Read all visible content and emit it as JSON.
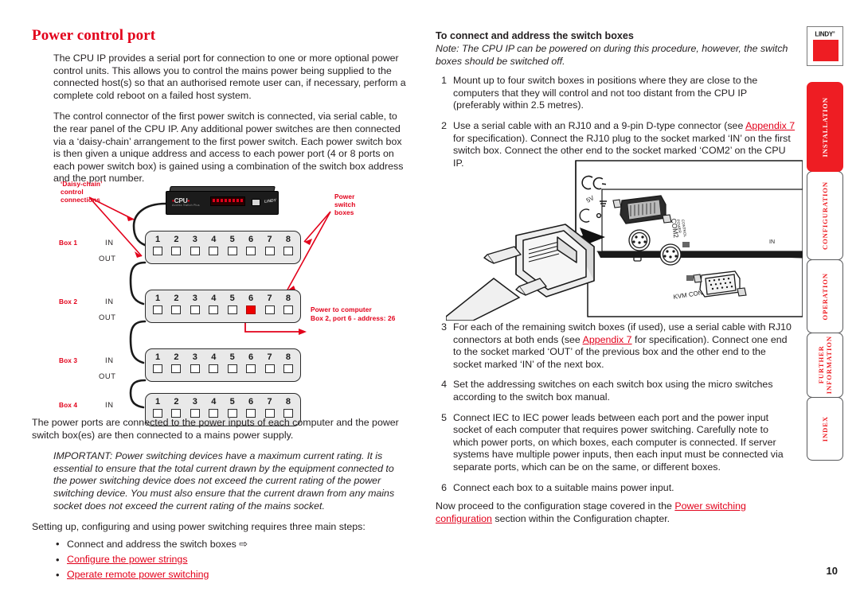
{
  "document": {
    "page_number": "10"
  },
  "left_column": {
    "title": "Power control port",
    "paragraphs": [
      "The CPU IP provides a serial port for connection to one or more optional power control units. This allows you to control the mains power being supplied to the connected host(s) so that an authorised remote user can, if necessary, perform a complete cold reboot on a failed host system.",
      "The control connector of the first power switch is connected, via serial cable, to the rear panel of the CPU IP. Any additional power switches are then connected via a ‘daisy-chain’ arrangement to the first power switch. Each power switch box is then given a unique address and access to each power port (4 or 8 ports on each power switch box) is gained using a combination of the switch box address and the port number."
    ],
    "after_diagram": "The power ports are connected to the power inputs of each computer and the power switch box(es) are then connected to a mains power supply.",
    "important_note": "IMPORTANT: Power switching devices have a maximum current rating. It is essential to ensure that the total current drawn by the equipment connected to the power switching device does not exceed the current rating of the power switching device. You must also ensure that the current drawn from any mains socket does not exceed the current rating of the mains socket.",
    "steps_intro": "Setting up, configuring and using power switching requires three main steps:",
    "bullets": [
      {
        "text": "Connect and address the switch boxes",
        "link": false,
        "arrow": "⇨"
      },
      {
        "text": "Configure the power strings",
        "link": true,
        "arrow": ""
      },
      {
        "text": "Operate remote power switching",
        "link": true,
        "arrow": ""
      }
    ]
  },
  "diagram": {
    "labels": {
      "daisy_chain": "‘Daisy-chain’\ncontrol\nconnections",
      "daisy_chain_l1": "‘Daisy-chain’",
      "daisy_chain_l2": "control",
      "daisy_chain_l3": "connections",
      "power_switch_boxes_l1": "Power",
      "power_switch_boxes_l2": "switch",
      "power_switch_boxes_l3": "boxes",
      "callout_l1": "Power to computer",
      "callout_l2": "Box 2, port 6 - address: 26",
      "in": "IN",
      "out": "OUT"
    },
    "device": {
      "logo": "CPU",
      "sub": "Access Switch Plus",
      "brand": "LINDY"
    },
    "boxes": [
      {
        "name": "Box 1",
        "has_in": true,
        "has_out": true,
        "ports": [
          "1",
          "2",
          "3",
          "4",
          "5",
          "6",
          "7",
          "8"
        ],
        "active_port": null
      },
      {
        "name": "Box 2",
        "has_in": true,
        "has_out": true,
        "ports": [
          "1",
          "2",
          "3",
          "4",
          "5",
          "6",
          "7",
          "8"
        ],
        "active_port": 6
      },
      {
        "name": "Box 3",
        "has_in": true,
        "has_out": true,
        "ports": [
          "1",
          "2",
          "3",
          "4",
          "5",
          "6",
          "7",
          "8"
        ],
        "active_port": null
      },
      {
        "name": "Box 4",
        "has_in": true,
        "has_out": false,
        "ports": [
          "1",
          "2",
          "3",
          "4",
          "5",
          "6",
          "7",
          "8"
        ],
        "active_port": null
      }
    ]
  },
  "right_column": {
    "title": "To connect and address the switch boxes",
    "note": "Note: The CPU IP can be powered on during this procedure, however, the switch boxes should be switched off.",
    "steps_group_1": [
      {
        "num": "1",
        "parts": [
          {
            "t": "Mount up to four switch boxes in positions where they are close to the computers that they will control and not too distant from the CPU IP (preferably within 2.5 metres).",
            "link": false
          }
        ]
      },
      {
        "num": "2",
        "parts": [
          {
            "t": "Use a serial cable with an RJ10 and a 9-pin D-type connector (see ",
            "link": false
          },
          {
            "t": "Appendix 7",
            "link": true
          },
          {
            "t": " for specification). Connect the RJ10 plug to the socket marked ‘IN’ on the first switch box. Connect the other end to the socket marked ‘COM2’ on the CPU IP.",
            "link": false
          }
        ]
      }
    ],
    "steps_group_2": [
      {
        "num": "3",
        "parts": [
          {
            "t": "For each of the remaining switch boxes (if used), use a serial cable with RJ10 connectors at both ends (see ",
            "link": false
          },
          {
            "t": "Appendix 7",
            "link": true
          },
          {
            "t": " for specification). Connect one end to the socket marked ‘OUT’ of the previous box and the other end to the socket marked ‘IN’ of the next box.",
            "link": false
          }
        ]
      },
      {
        "num": "4",
        "parts": [
          {
            "t": "Set the addressing switches on each switch box using the micro switches according to the switch box manual.",
            "link": false
          }
        ]
      },
      {
        "num": "5",
        "parts": [
          {
            "t": "Connect IEC to IEC power leads between each port and the power input socket of each computer that requires power switching. Carefully note to which power ports, on which boxes, each computer is connected. If server systems have multiple power inputs, then each input must be connected via separate ports, which can be on the same, or different boxes.",
            "link": false
          }
        ]
      },
      {
        "num": "6",
        "parts": [
          {
            "t": "Connect each box to a suitable mains power input.",
            "link": false
          }
        ]
      }
    ],
    "closing": [
      {
        "t": "Now proceed to the configuration stage covered in the ",
        "link": false
      },
      {
        "t": "Power switching configuration",
        "link": true
      },
      {
        "t": " section within the Configuration chapter.",
        "link": false
      }
    ],
    "illustration": {
      "labels": {
        "ce": "CE",
        "voltage": "5V",
        "com2_l1": "COM2",
        "com2_l2": "POWER",
        "com2_l3": "CONTROL",
        "kvm_console": "KVM CONSOLE",
        "in": "IN"
      }
    }
  },
  "sidebar": {
    "logo": {
      "word": "LINDY",
      "mark": "®"
    },
    "tabs": [
      {
        "label": "INSTALLATION",
        "active": true
      },
      {
        "label": "CONFIGURATION",
        "active": false
      },
      {
        "label": "OPERATION",
        "active": false
      },
      {
        "label": "FURTHER\nINFORMATION",
        "active": false,
        "line1": "FURTHER",
        "line2": "INFORMATION"
      },
      {
        "label": "INDEX",
        "active": false
      }
    ]
  },
  "colors": {
    "accent_red": "#e2001a",
    "tab_red": "#ee1d23",
    "text": "#231f20"
  }
}
